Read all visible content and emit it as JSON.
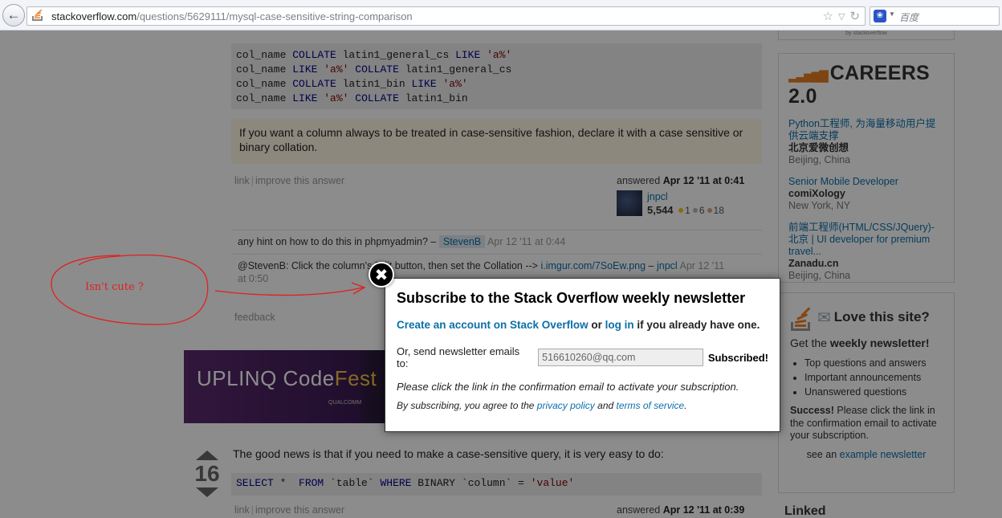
{
  "browser": {
    "url_host": "stackoverflow.com",
    "url_path": "/questions/5629111/mysql-case-sensitive-string-comparison",
    "search_placeholder": "百度"
  },
  "answer1": {
    "code_lines": [
      [
        {
          "t": "col_name ",
          "c": ""
        },
        {
          "t": "COLLATE",
          "c": "kw"
        },
        {
          "t": " latin1_general_cs ",
          "c": ""
        },
        {
          "t": "LIKE",
          "c": "kw"
        },
        {
          "t": " ",
          "c": ""
        },
        {
          "t": "'a%'",
          "c": "str"
        }
      ],
      [
        {
          "t": "col_name ",
          "c": ""
        },
        {
          "t": "LIKE",
          "c": "kw"
        },
        {
          "t": " ",
          "c": ""
        },
        {
          "t": "'a%'",
          "c": "str"
        },
        {
          "t": " ",
          "c": ""
        },
        {
          "t": "COLLATE",
          "c": "kw"
        },
        {
          "t": " latin1_general_cs",
          "c": ""
        }
      ],
      [
        {
          "t": "col_name ",
          "c": ""
        },
        {
          "t": "COLLATE",
          "c": "kw"
        },
        {
          "t": " latin1_bin ",
          "c": ""
        },
        {
          "t": "LIKE",
          "c": "kw"
        },
        {
          "t": " ",
          "c": ""
        },
        {
          "t": "'a%'",
          "c": "str"
        }
      ],
      [
        {
          "t": "col_name ",
          "c": ""
        },
        {
          "t": "LIKE",
          "c": "kw"
        },
        {
          "t": " ",
          "c": ""
        },
        {
          "t": "'a%'",
          "c": "str"
        },
        {
          "t": " ",
          "c": ""
        },
        {
          "t": "COLLATE",
          "c": "kw"
        },
        {
          "t": " latin1_bin",
          "c": ""
        }
      ]
    ],
    "note": "If you want a column always to be treated in case-sensitive fashion, declare it with a case sensitive or binary collation.",
    "link_label": "link",
    "improve_label": "improve this answer",
    "answered_prefix": "answered",
    "answered_date": "Apr 12 '11 at 0:41",
    "user_name": "jnpcl",
    "user_rep": "5,544",
    "gold": "1",
    "silver": "6",
    "bronze": "18"
  },
  "comments": [
    {
      "text": "any hint on how to do this in phpmyadmin? –",
      "user": "StevenB",
      "date": "Apr 12 '11 at 0:44"
    },
    {
      "text_before": "@StevenB: Click the column's Edit button, then set the Collation -->",
      "link": "i.imgur.com/7SoEw.png",
      "sep": "–",
      "user": "jnpcl",
      "date": "Apr 12 '11",
      "date2": "at 0:50"
    }
  ],
  "feedback_label": "feedback",
  "ad": {
    "logo_a": "UPLINQ",
    "logo_b": "Code",
    "logo_c": "Fest",
    "sub": "QUALCOMM"
  },
  "answer2": {
    "votes": "16",
    "text": "The good news is that if you need to make a case-sensitive query, it is very easy to do:",
    "code": [
      {
        "t": "SELECT",
        "c": "kw"
      },
      {
        "t": " *  ",
        "c": ""
      },
      {
        "t": "FROM",
        "c": "kw"
      },
      {
        "t": " `table` ",
        "c": ""
      },
      {
        "t": "WHERE",
        "c": "kw"
      },
      {
        "t": " BINARY `column` = ",
        "c": ""
      },
      {
        "t": "'value'",
        "c": "str"
      }
    ],
    "link_label": "link",
    "improve_label": "improve this answer",
    "answered_prefix": "answered",
    "answered_date": "Apr 12 '11 at 0:39"
  },
  "sidebar": {
    "careers_by": "by stackoverflow",
    "careers_logo": "CAREERS 2.0",
    "jobs": [
      {
        "title": "Python工程师, 为海量移动用户提供云端支撑",
        "company": "北京爱微创想",
        "location": "Beijing, China"
      },
      {
        "title": "Senior Mobile Developer",
        "company": "comiXology",
        "location": "New York, NY"
      },
      {
        "title": "前端工程师(HTML/CSS/JQuery)-北京 | UI developer for premium travel...",
        "company": "Zanadu.cn",
        "location": "Beijing, China"
      }
    ],
    "love_title": "Love this site?",
    "get_weekly_prefix": "Get the",
    "get_weekly_bold": "weekly newsletter!",
    "list": [
      "Top questions and answers",
      "Important announcements",
      "Unanswered questions"
    ],
    "success_bold": "Success!",
    "success_text": "Please click the link in the confirmation email to activate your subscription.",
    "see_an": "see an",
    "example_link": "example newsletter",
    "linked_title": "Linked"
  },
  "annotation": {
    "text": "Isn't cute ?"
  },
  "modal": {
    "title": "Subscribe to the Stack Overflow weekly newsletter",
    "create_link": "Create an account on Stack Overflow",
    "or": "or",
    "login_link": "log in",
    "if_already": "if you already have one.",
    "send_label": "Or, send newsletter emails to:",
    "email_value": "516610260@qq.com",
    "subscribed": "Subscribed!",
    "confirm": "Please click the link in the confirmation email to activate your subscription.",
    "terms_prefix": "By subscribing, you agree to the",
    "privacy_link": "privacy policy",
    "and": "and",
    "terms_link": "terms of service",
    "period": "."
  },
  "colors": {
    "link": "#0b6fa9",
    "overlay": "rgba(0,0,0,0.45)",
    "annotation": "#e02020",
    "careers_accent": "#e67e22"
  }
}
